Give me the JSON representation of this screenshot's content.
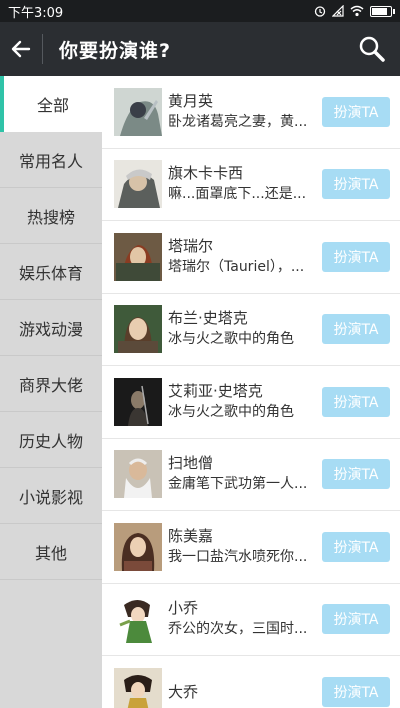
{
  "status_bar": {
    "time": "下午3:09"
  },
  "header": {
    "title": "你要扮演谁?"
  },
  "sidebar": {
    "items": [
      {
        "label": "全部",
        "active": true
      },
      {
        "label": "常用名人",
        "active": false
      },
      {
        "label": "热搜榜",
        "active": false
      },
      {
        "label": "娱乐体育",
        "active": false
      },
      {
        "label": "游戏动漫",
        "active": false
      },
      {
        "label": "商界大佬",
        "active": false
      },
      {
        "label": "历史人物",
        "active": false
      },
      {
        "label": "小说影视",
        "active": false
      },
      {
        "label": "其他",
        "active": false
      }
    ]
  },
  "list": {
    "button_label": "扮演TA",
    "rows": [
      {
        "name": "黄月英",
        "desc": "卧龙诸葛亮之妻，黄..."
      },
      {
        "name": "旗木卡卡西",
        "desc": "嘛...面罩底下...还是..."
      },
      {
        "name": "塔瑞尔",
        "desc": "塔瑞尔（Tauriel），..."
      },
      {
        "name": "布兰·史塔克",
        "desc": "冰与火之歌中的角色"
      },
      {
        "name": "艾莉亚·史塔克",
        "desc": "冰与火之歌中的角色"
      },
      {
        "name": "扫地僧",
        "desc": "金庸笔下武功第一人..."
      },
      {
        "name": "陈美嘉",
        "desc": "我一口盐汽水喷死你..."
      },
      {
        "name": "小乔",
        "desc": "乔公的次女，三国时..."
      },
      {
        "name": "大乔",
        "desc": ""
      }
    ]
  },
  "colors": {
    "accent": "#2fc3a8",
    "header_bg": "#2b2e32",
    "button_bg": "#a7dcf4"
  }
}
